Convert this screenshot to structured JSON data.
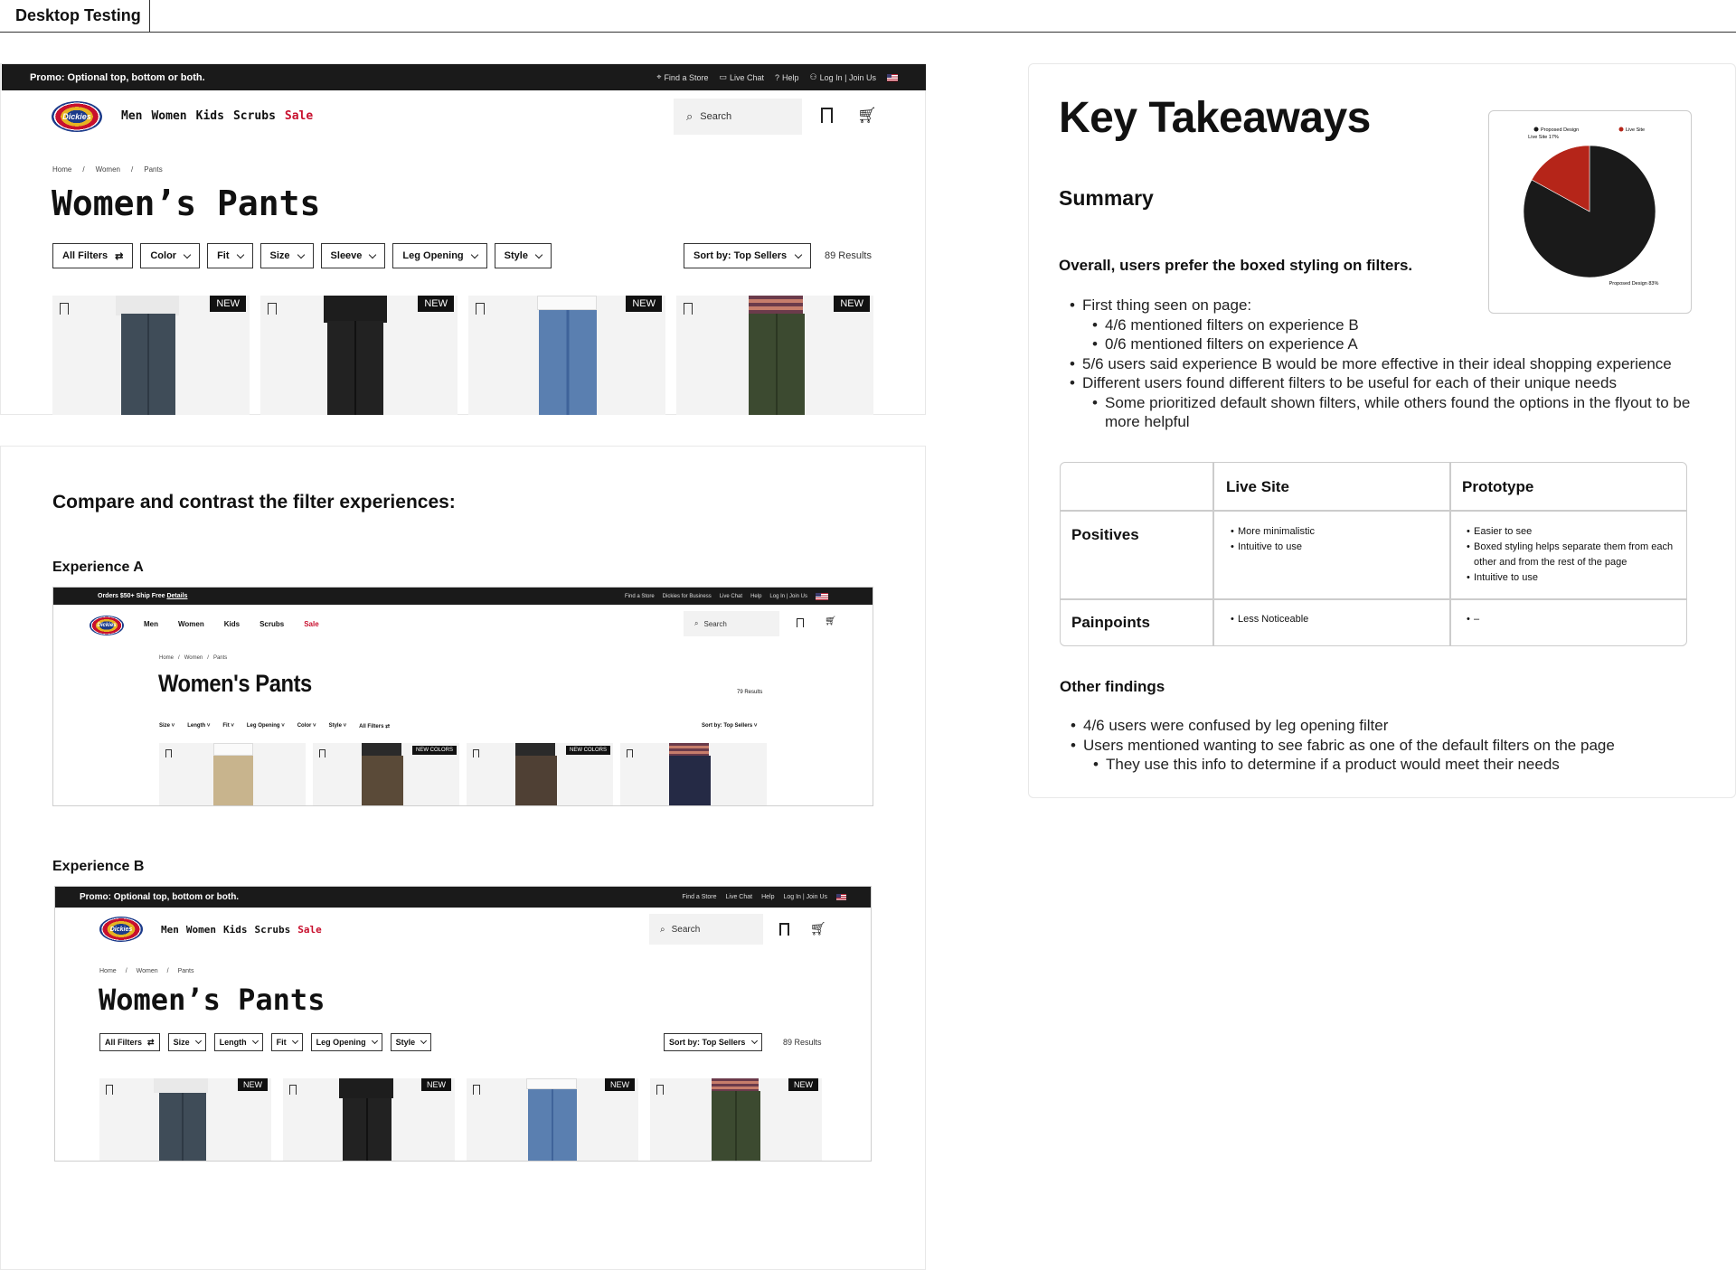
{
  "frame": {
    "title": "Desktop Testing"
  },
  "mock_main": {
    "promo": "Promo: Optional top, bottom or both.",
    "util": [
      "Find a Store",
      "Live Chat",
      "Help",
      "Log In | Join Us"
    ],
    "nav": [
      "Men",
      "Women",
      "Kids",
      "Scrubs",
      "Sale"
    ],
    "logo": "Dickies",
    "search_placeholder": "Search",
    "breadcrumb": [
      "Home",
      "/",
      "Women",
      "/",
      "Pants"
    ],
    "title": "Women’s Pants",
    "filters": [
      "All Filters",
      "Color",
      "Fit",
      "Size",
      "Sleeve",
      "Leg Opening",
      "Style"
    ],
    "sort": "Sort by: Top Sellers",
    "results": "89 Results",
    "badge": "NEW"
  },
  "compare": {
    "heading": "Compare and contrast the filter experiences:",
    "exp_a_label": "Experience A",
    "exp_b_label": "Experience B"
  },
  "exp_a": {
    "promo": "Orders $50+ Ship Free",
    "promo_link": "Details",
    "util": [
      "Find a Store",
      "Dickies for Business",
      "Live Chat",
      "Help",
      "Log In | Join Us"
    ],
    "nav": [
      "Men",
      "Women",
      "Kids",
      "Scrubs",
      "Sale"
    ],
    "logo": "Dickies",
    "search_placeholder": "Search",
    "breadcrumb": [
      "Home",
      "/",
      "Women",
      "/",
      "Pants"
    ],
    "title": "Women's Pants",
    "results": "79 Results",
    "filters": [
      "Size",
      "Length",
      "Fit",
      "Leg Opening",
      "Color",
      "Style",
      "All Filters"
    ],
    "sort": "Sort by: Top Sellers",
    "badge": "NEW COLORS"
  },
  "exp_b": {
    "promo": "Promo: Optional top, bottom or both.",
    "util": [
      "Find a Store",
      "Live Chat",
      "Help",
      "Log In | Join Us"
    ],
    "nav": [
      "Men",
      "Women",
      "Kids",
      "Scrubs",
      "Sale"
    ],
    "logo": "Dickies",
    "search_placeholder": "Search",
    "breadcrumb": [
      "Home",
      "/",
      "Women",
      "/",
      "Pants"
    ],
    "title": "Women’s Pants",
    "filters": [
      "All Filters",
      "Size",
      "Length",
      "Fit",
      "Leg Opening",
      "Style"
    ],
    "sort": "Sort by: Top Sellers",
    "results": "89 Results",
    "badge": "NEW"
  },
  "takeaways": {
    "title": "Key Takeaways",
    "summary_label": "Summary",
    "lead": "Overall, users prefer the boxed styling on filters.",
    "bullets": {
      "b1": "First thing seen on page:",
      "b1a": "4/6 mentioned filters on experience B",
      "b1b": "0/6 mentioned filters on experience A",
      "b2": "5/6 users said experience B would be more effective in their ideal shopping experience",
      "b3": "Different users found different filters to be useful for each of their unique needs",
      "b3a": "Some prioritized default shown filters, while others found the options in the flyout to be more helpful"
    },
    "table": {
      "col_live": "Live Site",
      "col_proto": "Prototype",
      "row_pos": "Positives",
      "row_pain": "Painpoints",
      "pos_live": [
        "More minimalistic",
        "Intuitive to use"
      ],
      "pos_proto": [
        "Easier to see",
        "Boxed styling helps separate them from each other and from the rest of the page",
        "Intuitive to use"
      ],
      "pain_live": [
        "Less Noticeable"
      ],
      "pain_proto": [
        "–"
      ]
    },
    "other_label": "Other findings",
    "other": {
      "o1": "4/6 users were confused by leg opening filter",
      "o2": "Users mentioned wanting to see fabric as one of the default filters on the page",
      "o2a": "They use this info to determine if a product would meet their needs"
    }
  },
  "chart_data": {
    "type": "pie",
    "legend": [
      "Proposed Design",
      "Live Site"
    ],
    "values": [
      83,
      17
    ],
    "colors": [
      "#1a1a1a",
      "#b52519"
    ],
    "labels": [
      "Proposed Design 83%",
      "Live Site 17%"
    ],
    "legend_position": "top"
  }
}
